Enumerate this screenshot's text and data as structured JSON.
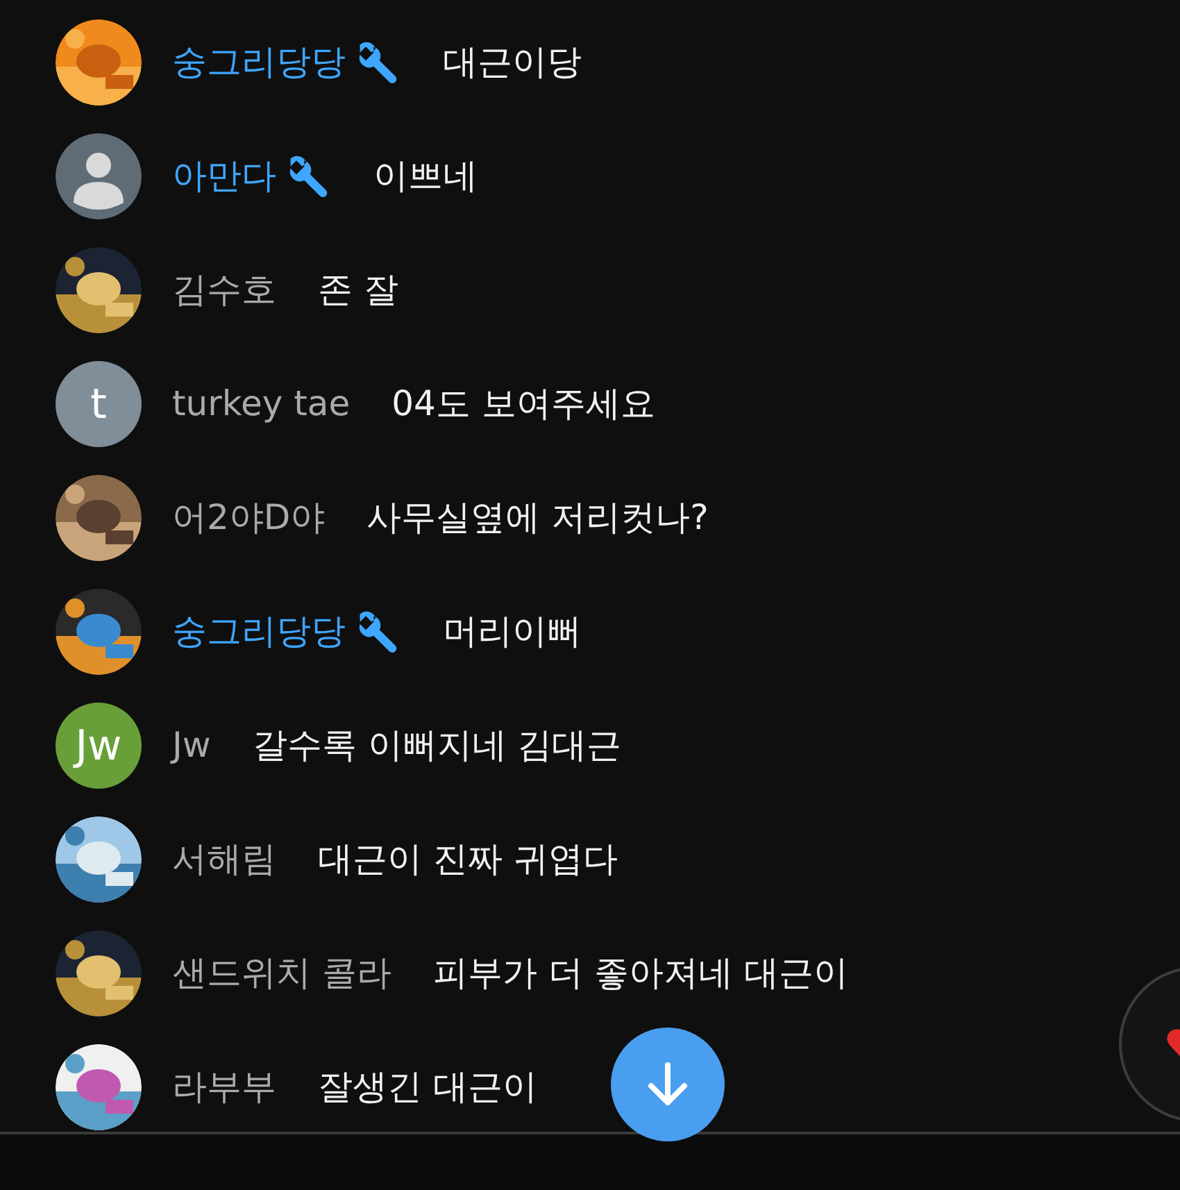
{
  "messages": [
    {
      "author": "숭그리당당",
      "moderator": true,
      "text": "대근이당"
    },
    {
      "avatar": {
        "kind": "default"
      },
      "author": "아만다",
      "moderator": true,
      "text": "이쁘네"
    },
    {
      "author": "김수호",
      "moderator": false,
      "text": "존 잘"
    },
    {
      "avatar": {
        "kind": "letter",
        "letter": "t",
        "color": "#7f8e99"
      },
      "author": "turkey tae",
      "moderator": false,
      "text": "04도 보여주세요"
    },
    {
      "author": "어2야D야",
      "moderator": false,
      "text": "사무실옆에 저리컷나?"
    },
    {
      "author": "숭그리당당",
      "moderator": true,
      "text": "머리이뻐"
    },
    {
      "avatar": {
        "kind": "letter",
        "letter": "Jw",
        "color": "#689f38"
      },
      "author": "Jw",
      "moderator": false,
      "text": "갈수록 이뻐지네 김대근"
    },
    {
      "author": "서해림",
      "moderator": false,
      "text": "대근이 진짜 귀엽다"
    },
    {
      "author": "샌드위치 콜라",
      "moderator": false,
      "text": "피부가 더 좋아져네 대근이"
    },
    {
      "author": "라부부",
      "moderator": false,
      "text": "잘생긴 대근이"
    }
  ]
}
